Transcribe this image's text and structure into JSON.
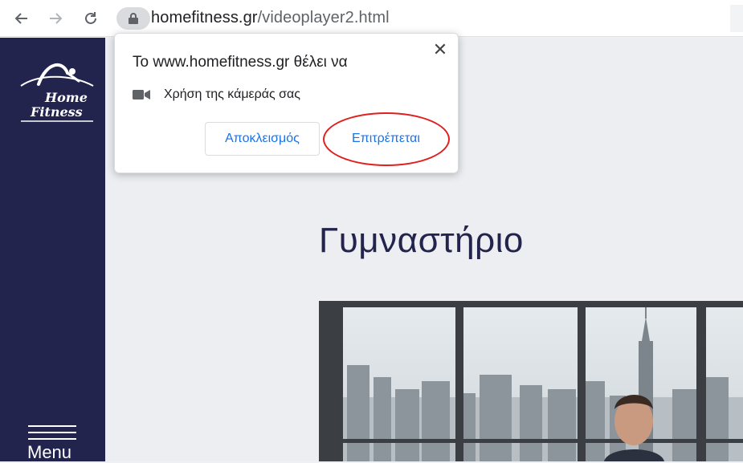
{
  "browser": {
    "url_domain": "homefitness.gr",
    "url_path": "/videoplayer2.html",
    "icons": {
      "back": "back-arrow-icon",
      "forward": "forward-arrow-icon",
      "reload": "reload-icon",
      "lock": "lock-icon"
    }
  },
  "sidebar": {
    "logo_line1": "Home",
    "logo_line2": "Fitness",
    "menu_label": "Menu"
  },
  "main": {
    "title": "Γυμναστήριο"
  },
  "permission_popup": {
    "title": "Το www.homefitness.gr θέλει να",
    "permission_text": "Χρήση της κάμεράς σας",
    "block_label": "Αποκλεισμός",
    "allow_label": "Επιτρέπεται",
    "icons": {
      "camera": "camera-icon",
      "close": "close-icon"
    },
    "annotation_color": "#e0201e"
  },
  "colors": {
    "sidebar_bg": "#23244d",
    "title_color": "#23244d",
    "link_blue": "#1a73e8"
  }
}
